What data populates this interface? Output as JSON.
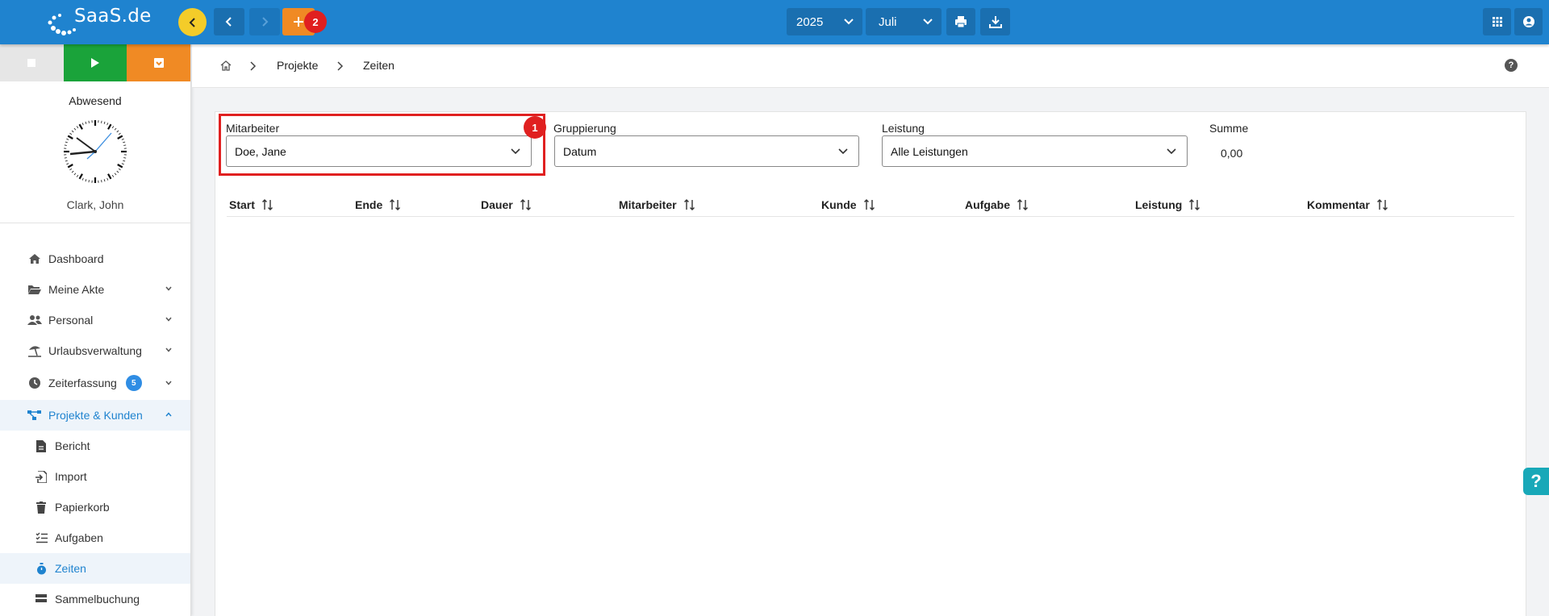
{
  "brand": {
    "logo_text": "SaaS.de"
  },
  "topbar": {
    "add_badge": "2",
    "year": "2025",
    "month": "Juli"
  },
  "sidebar": {
    "status": "Abwesend",
    "user": "Clark, John",
    "items": [
      {
        "label": "Dashboard"
      },
      {
        "label": "Meine Akte"
      },
      {
        "label": "Personal"
      },
      {
        "label": "Urlaubsverwaltung"
      },
      {
        "label": "Zeiterfassung",
        "badge": "5"
      },
      {
        "label": "Projekte & Kunden"
      }
    ],
    "subitems": [
      {
        "label": "Bericht"
      },
      {
        "label": "Import"
      },
      {
        "label": "Papierkorb"
      },
      {
        "label": "Aufgaben"
      },
      {
        "label": "Zeiten"
      },
      {
        "label": "Sammelbuchung"
      }
    ]
  },
  "breadcrumb": {
    "items": [
      "Projekte",
      "Zeiten"
    ]
  },
  "filters": {
    "mitarbeiter": {
      "label": "Mitarbeiter",
      "value": "Doe, Jane"
    },
    "gruppierung": {
      "label": "Gruppierung",
      "value": "Datum"
    },
    "leistung": {
      "label": "Leistung",
      "value": "Alle Leistungen"
    },
    "summe": {
      "label": "Summe",
      "value": "0,00"
    },
    "highlight_badge": "1"
  },
  "table": {
    "columns": [
      "Start",
      "Ende",
      "Dauer",
      "Mitarbeiter",
      "Kunde",
      "Aufgabe",
      "Leistung",
      "Kommentar"
    ]
  },
  "colors": {
    "topbar": "#1f83cf",
    "accent_yellow": "#f4cc29",
    "accent_orange": "#f08a24",
    "green": "#1aa33a",
    "highlight_red": "#e02020"
  }
}
